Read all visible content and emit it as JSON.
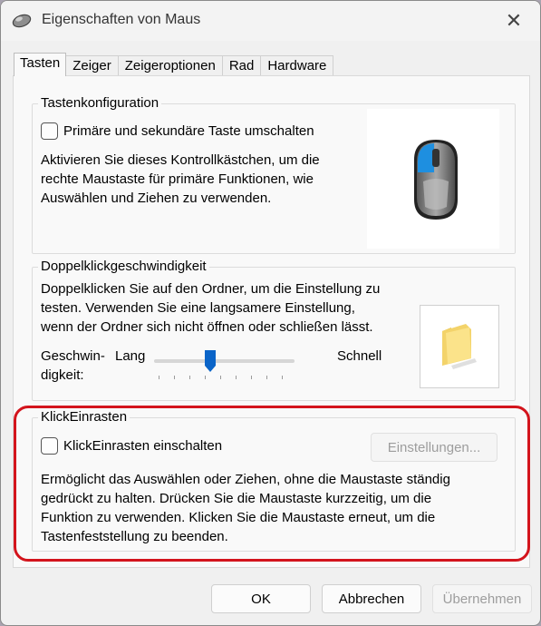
{
  "window": {
    "title": "Eigenschaften von Maus",
    "close_glyph": "✕"
  },
  "tabs": [
    {
      "label": "Tasten",
      "active": true
    },
    {
      "label": "Zeiger",
      "active": false
    },
    {
      "label": "Zeigeroptionen",
      "active": false
    },
    {
      "label": "Rad",
      "active": false
    },
    {
      "label": "Hardware",
      "active": false
    }
  ],
  "button_config": {
    "title": "Tastenkonfiguration",
    "checkbox_label": "Primäre und sekundäre Taste umschalten",
    "checked": false,
    "description": [
      "Aktivieren Sie dieses Kontrollkästchen, um die",
      "rechte Maustaste für primäre Funktionen, wie",
      "Auswählen und Ziehen zu verwenden."
    ]
  },
  "double_click": {
    "title": "Doppelklickgeschwindigkeit",
    "description": [
      "Doppelklicken Sie auf den Ordner, um die Einstellung zu",
      "testen. Verwenden Sie eine langsamere Einstellung,",
      "wenn der Ordner sich nicht öffnen oder schließen lässt."
    ],
    "speed_label_line1": "Geschwin-",
    "speed_label_line2": "digkeit:",
    "slow_label": "Lang",
    "fast_label": "Schnell",
    "slider_value_fraction": 0.4
  },
  "click_lock": {
    "title": "KlickEinrasten",
    "checkbox_label": "KlickEinrasten einschalten",
    "checked": false,
    "settings_button": "Einstellungen...",
    "settings_enabled": false,
    "description": [
      "Ermöglicht das Auswählen oder Ziehen, ohne die Maustaste ständig",
      "gedrückt zu halten. Drücken Sie die Maustaste kurzzeitig, um die",
      "Funktion zu verwenden. Klicken Sie die Maustaste erneut, um die",
      "Tastenfeststellung zu beenden."
    ]
  },
  "footer": {
    "ok": "OK",
    "cancel": "Abbrechen",
    "apply": "Übernehmen",
    "apply_enabled": false
  },
  "colors": {
    "highlight": "#d3141c",
    "mouse_accent": "#1e8fe0"
  }
}
